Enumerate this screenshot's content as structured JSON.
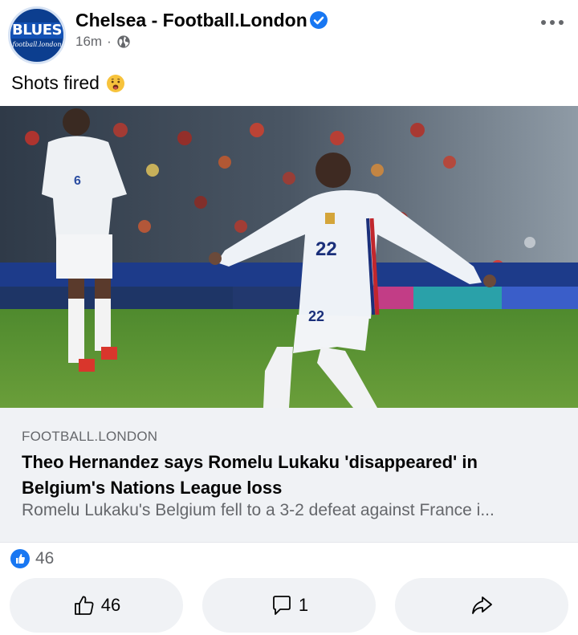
{
  "post": {
    "page_name": "Chelsea - Football.London",
    "time_ago": "16m",
    "separator": "·",
    "avatar": {
      "logo_text": "BLUES",
      "logo_subtext": "football.london"
    },
    "caption": "Shots fired",
    "caption_emoji": "anguished-face-emoji",
    "verified_icon": "verified-badge-icon",
    "audience_icon": "globe-icon"
  },
  "photo": {
    "subject": "Football player in white kit with number 22 striking a ball, teammate number 6 behind",
    "shirt_numbers": [
      "22",
      "6"
    ]
  },
  "link_preview": {
    "source": "FOOTBALL.LONDON",
    "headline": "Theo Hernandez says Romelu Lukaku 'disappeared' in Belgium's Nations League loss",
    "description": "Romelu Lukaku's Belgium fell to a 3-2 defeat against France i..."
  },
  "reactions": {
    "count": "46",
    "icon": "like-reaction-icon"
  },
  "actions": {
    "like_count": "46",
    "comment_count": "1",
    "like_icon": "thumbs-up-icon",
    "comment_icon": "comment-icon",
    "share_icon": "share-icon"
  },
  "colors": {
    "brand_blue": "#1877f2",
    "avatar_blue": "#0c3e8f",
    "secondary_text": "#65676b",
    "card_background": "#f0f2f5"
  }
}
